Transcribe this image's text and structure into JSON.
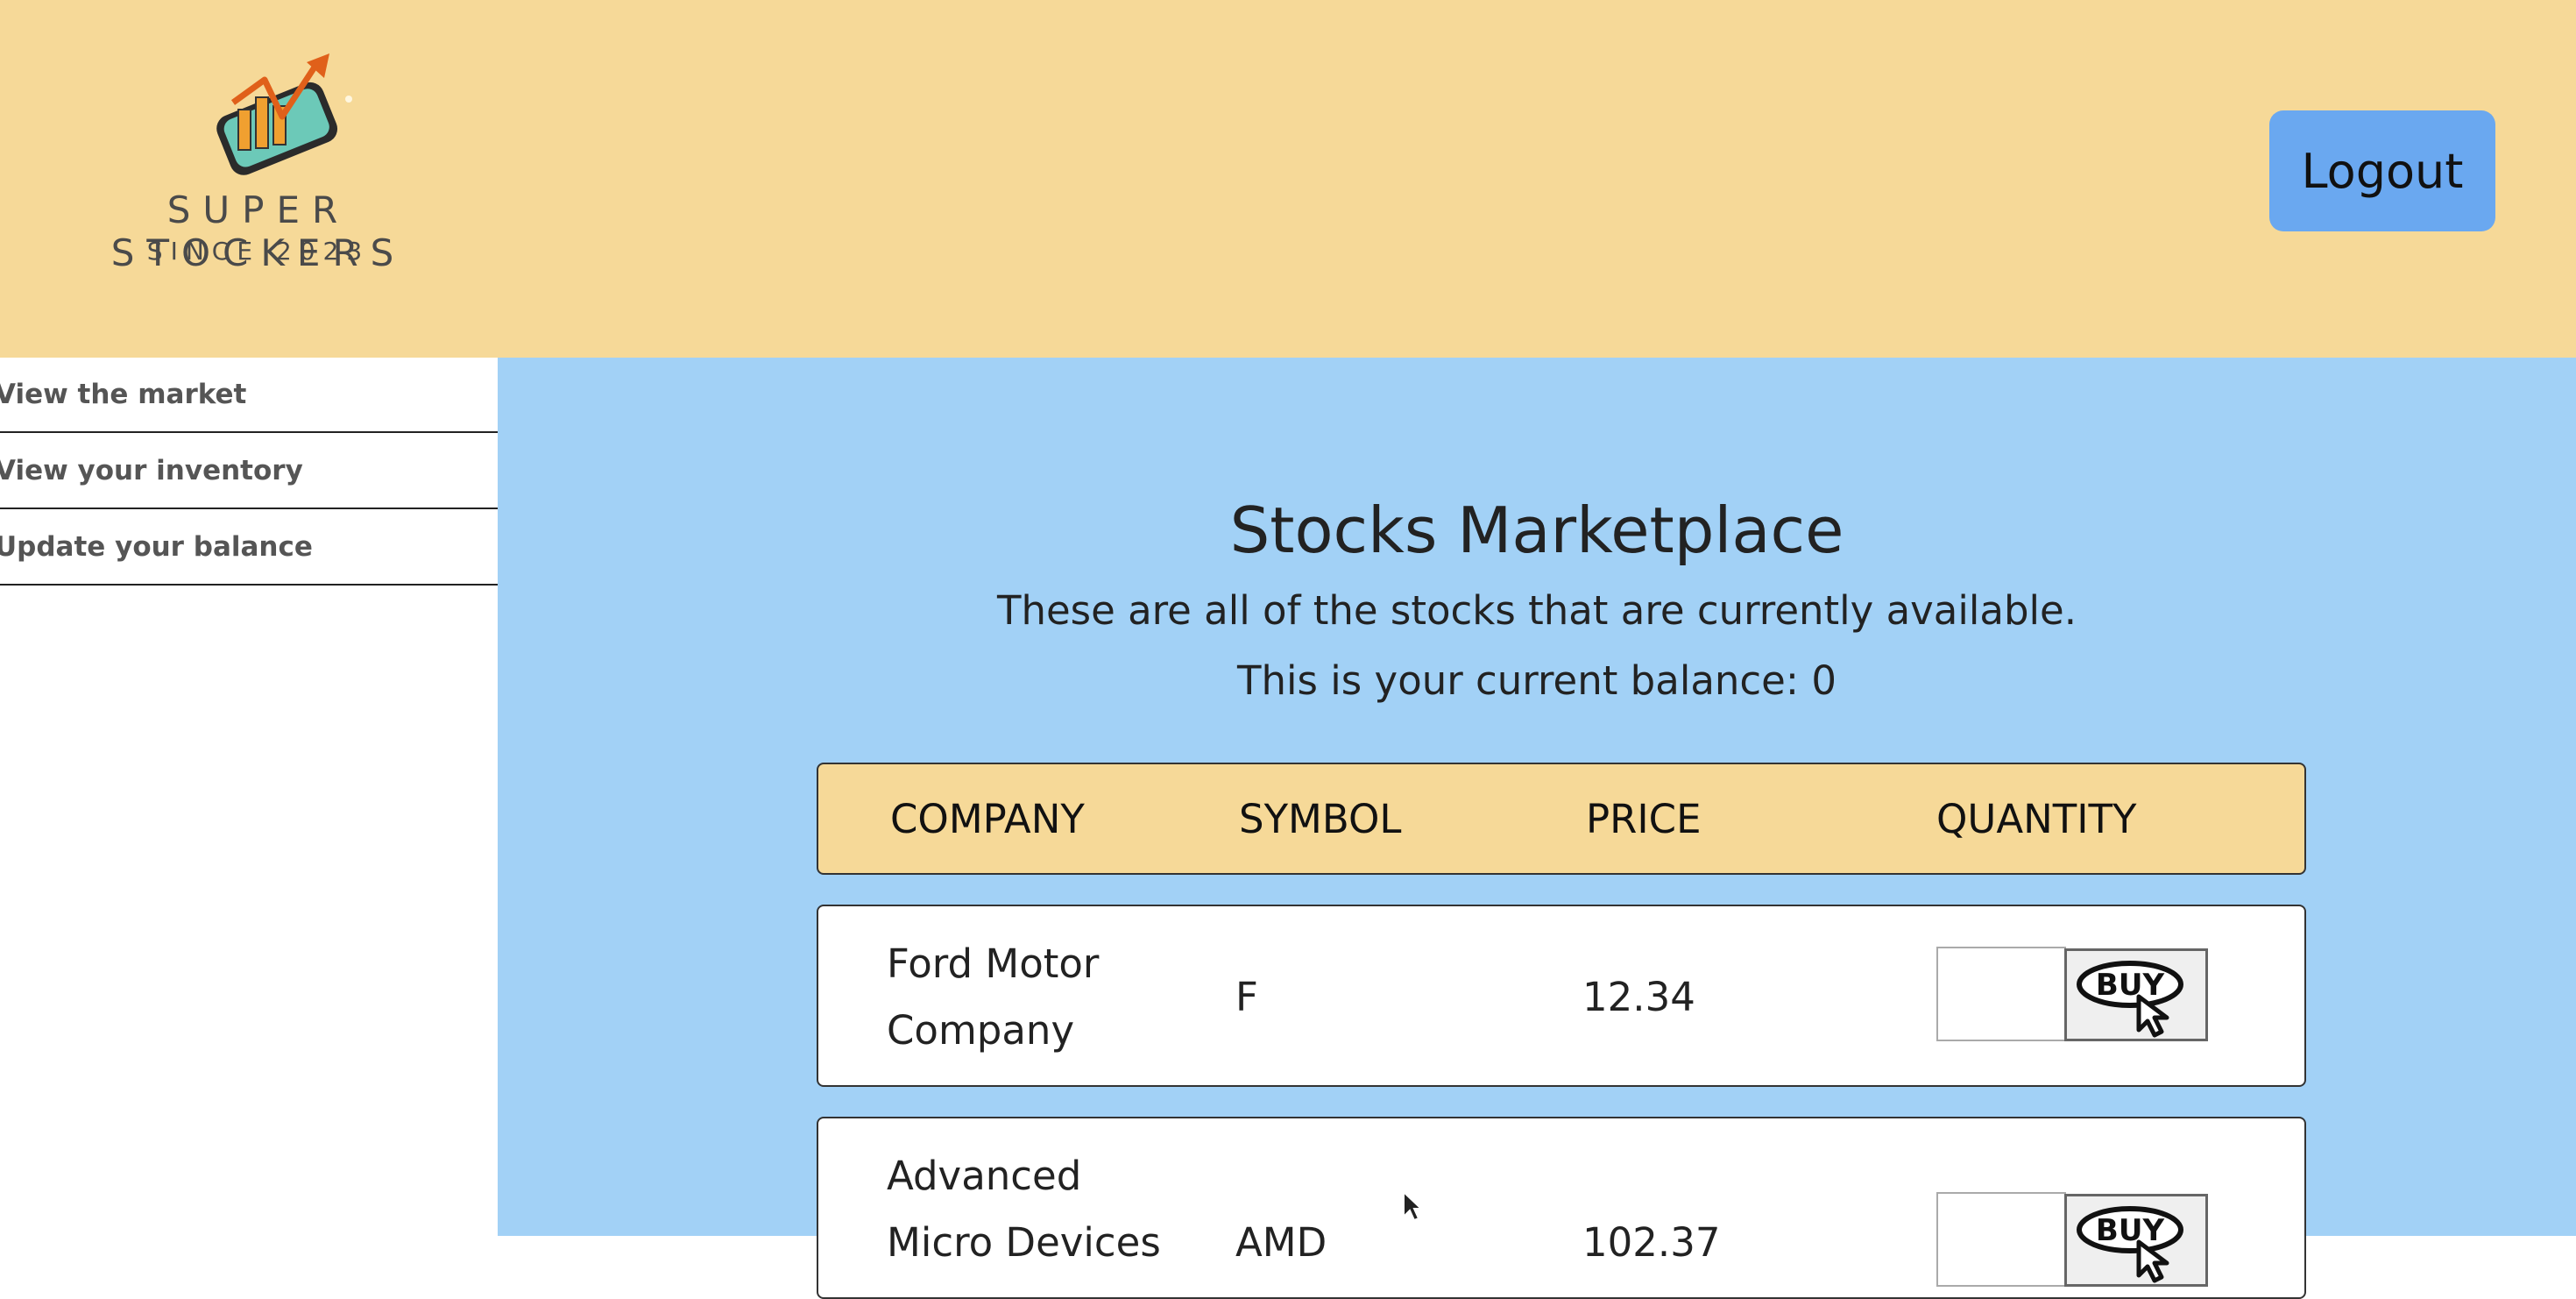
{
  "brand": {
    "name": "SUPER STOCKERS",
    "tagline": "SINCE 2023",
    "logo_icon": "chart-on-phone-icon"
  },
  "header": {
    "logout_label": "Logout"
  },
  "sidebar": {
    "items": [
      {
        "label": "View the market"
      },
      {
        "label": "View your inventory"
      },
      {
        "label": "Update your balance"
      }
    ]
  },
  "main": {
    "title": "Stocks Marketplace",
    "subtitle": "These are all of the stocks that are currently available.",
    "balance_text": "This is your current balance: 0"
  },
  "table": {
    "columns": [
      "COMPANY",
      "SYMBOL",
      "PRICE",
      "QUANTITY"
    ],
    "rows": [
      {
        "company": "Ford Motor Company",
        "symbol": "F",
        "price": "12.34",
        "quantity": "",
        "buy_label": "BUY"
      },
      {
        "company": "Advanced Micro Devices",
        "symbol": "AMD",
        "price": "102.37",
        "quantity": "",
        "buy_label": "BUY"
      }
    ]
  },
  "colors": {
    "header_bg": "#f6d998",
    "main_bg": "#a2d1f6",
    "logout_bg": "#6aa8f0",
    "sidebar_bg": "#ffffff"
  }
}
